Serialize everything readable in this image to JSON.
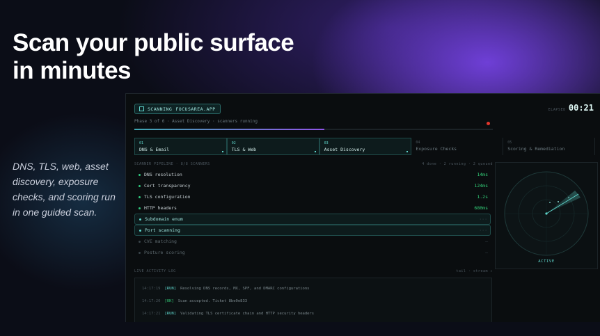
{
  "hero": {
    "title_line1": "Scan your public surface",
    "title_line2": "in minutes",
    "subtitle": "DNS, TLS, web, asset discovery, exposure checks, and scoring run in one guided scan."
  },
  "app": {
    "scan_label": "SCANNING",
    "domain": "FOCUSAREA.APP",
    "elapsed_label": "ELAPSED",
    "elapsed_value": "00:21",
    "phase_text": "Phase 3 of 6 · Asset Discovery · scanners running",
    "progress": 0.53,
    "steps": [
      {
        "num": "01",
        "label": "DNS & Email",
        "state": "done"
      },
      {
        "num": "02",
        "label": "TLS & Web",
        "state": "done"
      },
      {
        "num": "03",
        "label": "Asset Discovery",
        "state": "current"
      },
      {
        "num": "04",
        "label": "Exposure Checks",
        "state": "pending"
      },
      {
        "num": "05",
        "label": "Scoring & Remediation",
        "state": "pending"
      }
    ],
    "pipeline": {
      "title": "SCANNER PIPELINE · 8/8 SCANNERS",
      "summary": "4 done · 2 running · 2 queued",
      "rows": [
        {
          "name": "DNS resolution",
          "time": "14ms",
          "state": "done"
        },
        {
          "name": "Cert transparency",
          "time": "124ms",
          "state": "done"
        },
        {
          "name": "TLS configuration",
          "time": "1.2s",
          "state": "done"
        },
        {
          "name": "HTTP headers",
          "time": "680ms",
          "state": "done"
        },
        {
          "name": "Subdomain enum",
          "time": "···",
          "state": "running"
        },
        {
          "name": "Port scanning",
          "time": "···",
          "state": "running"
        },
        {
          "name": "CVE matching",
          "time": "—",
          "state": "queued"
        },
        {
          "name": "Posture scoring",
          "time": "—",
          "state": "queued"
        }
      ]
    },
    "radar": {
      "status": "ACTIVE"
    },
    "log": {
      "title": "LIVE ACTIVITY LOG",
      "controls": "tail · stream ▸",
      "lines": [
        {
          "time": "14:17:19",
          "tag": "[RUN]",
          "message": "Resolving DNS records, MX, SPF, and DMARC configurations"
        },
        {
          "time": "14:17:20",
          "tag": "[OK]",
          "message": "Scan accepted. Ticket 8be0e833"
        },
        {
          "time": "14:17:21",
          "tag": "[RUN]",
          "message": "Validating TLS certificate chain and HTTP security headers"
        }
      ]
    }
  },
  "colors": {
    "accent": "#5fd6cc",
    "success": "#33d17a",
    "alert": "#e2362c",
    "purple": "#8f55e8"
  }
}
